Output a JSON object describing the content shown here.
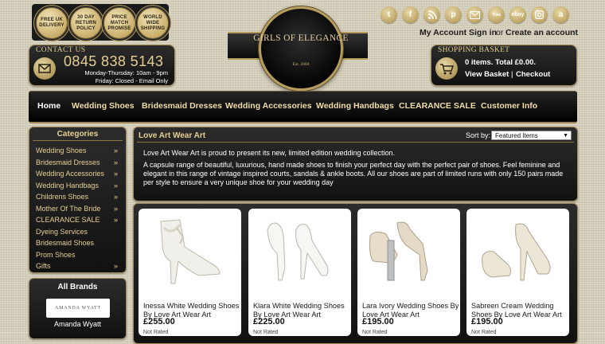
{
  "badges": [
    {
      "text": "FREE UK DELIVERY"
    },
    {
      "text": "30 DAY RETURN POLICY"
    },
    {
      "text": "PRICE MATCH PROMISE"
    },
    {
      "text": "WORLD WIDE SHIPPING"
    }
  ],
  "logo": {
    "title": "GIRLS OF ELEGANCE",
    "est": "Est. 2004"
  },
  "contact": {
    "heading": "CONTACT US",
    "phone": "0845 838 5143",
    "hours1": "Monday-Thursday: 10am - 9pm",
    "hours2": "Friday: Closed - Email Only"
  },
  "social": [
    "twitter-icon",
    "facebook-icon",
    "rss-icon",
    "pinterest-icon",
    "email-icon",
    "youtube-icon",
    "ebay-icon",
    "instagram-icon",
    "amazon-icon"
  ],
  "account": {
    "my_account": "My Account",
    "sign_in": "Sign in",
    "or": "or",
    "create": "Create an account"
  },
  "basket": {
    "heading": "SHOPPING BASKET",
    "summary": "0 items. Total £0.00.",
    "view": "View Basket",
    "sep": "|",
    "checkout": "Checkout"
  },
  "nav": [
    "Home",
    "Wedding Shoes",
    "Bridesmaid Dresses",
    "Wedding Accessories",
    "Wedding Handbags",
    "CLEARANCE SALE",
    "Customer Info"
  ],
  "sidebar": {
    "categories_title": "Categories",
    "items": [
      {
        "label": "Wedding Shoes",
        "arrow": true
      },
      {
        "label": "Bridesmaid Dresses",
        "arrow": true
      },
      {
        "label": "Wedding Accessories",
        "arrow": true
      },
      {
        "label": "Wedding Handbags",
        "arrow": true
      },
      {
        "label": "Childrens Shoes",
        "arrow": true
      },
      {
        "label": "Mother Of The Bride",
        "arrow": true
      },
      {
        "label": "CLEARANCE SALE",
        "arrow": true
      },
      {
        "label": "Dyeing Services",
        "arrow": false
      },
      {
        "label": "Bridesmaid Shoes",
        "arrow": false
      },
      {
        "label": "Prom Shoes",
        "arrow": false
      },
      {
        "label": "Gifts",
        "arrow": true
      }
    ],
    "arrow_glyph": "»",
    "brands_title": "All Brands",
    "brand_logo_text": "AMANDA WYATT",
    "brand_name": "Amanda Wyatt"
  },
  "main": {
    "title": "Love Art Wear Art",
    "sort_label": "Sort by:",
    "sort_value": "Featured Items",
    "desc1": "Love Art Wear Art is proud to present its new, limited edition wedding collection.",
    "desc2": "A capsule range of beautiful, luxurious, hand made shoes to finish your perfect day with the perfect pair of shoes. Feel feminine and elegant in this range of vintage inspired courts, sandals & ankle boots. All our shoes are part of limited runs with only 150 pairs made per style to ensure a very unique shoe for your wedding day"
  },
  "products": [
    {
      "name": "Inessa White Wedding Shoes By Love Art Wear Art",
      "price": "£255.00",
      "rating": "Not Rated"
    },
    {
      "name": "Klara White Wedding Shoes By Love Art Wear Art",
      "price": "£225.00",
      "rating": "Not Rated"
    },
    {
      "name": "Lara Ivory Wedding Shoes By Love Art Wear Art",
      "price": "£195.00",
      "rating": "Not Rated"
    },
    {
      "name": "Sabreen Cream Wedding Shoes By Love Art Wear Art",
      "price": "£195.00",
      "rating": "Not Rated"
    }
  ],
  "colors": {
    "gold": "#e7cf92",
    "black": "#111111",
    "accent_border": "#a08a58"
  }
}
